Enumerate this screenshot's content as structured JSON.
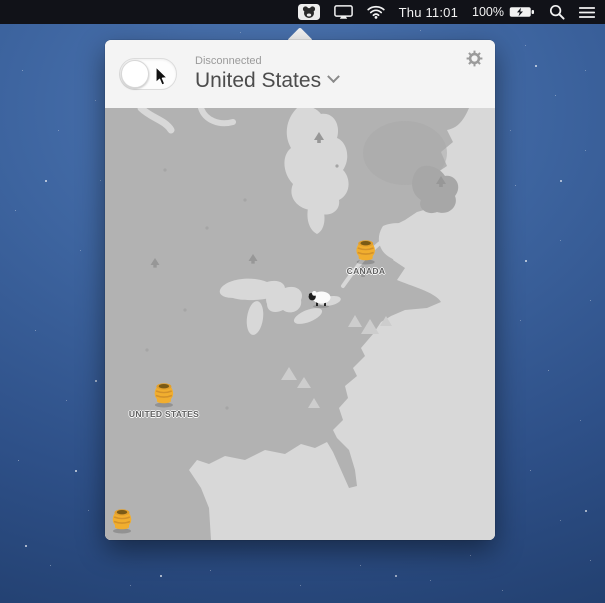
{
  "menu_bar": {
    "clock": "Thu 11:01",
    "battery_percent": "100%"
  },
  "popover": {
    "status_label": "Disconnected",
    "selected_country": "United States",
    "markers": [
      {
        "id": "canada",
        "label": "CANADA"
      },
      {
        "id": "united-states",
        "label": "UNITED STATES"
      },
      {
        "id": "bottom-left",
        "label": ""
      }
    ]
  },
  "colors": {
    "honey_yellow": "#f1ae2f",
    "map_land": "#b2b2b2",
    "map_water": "#d8d8d8",
    "menu_bar_bg": "#101014",
    "wallpaper_blue": "#3d649f"
  }
}
